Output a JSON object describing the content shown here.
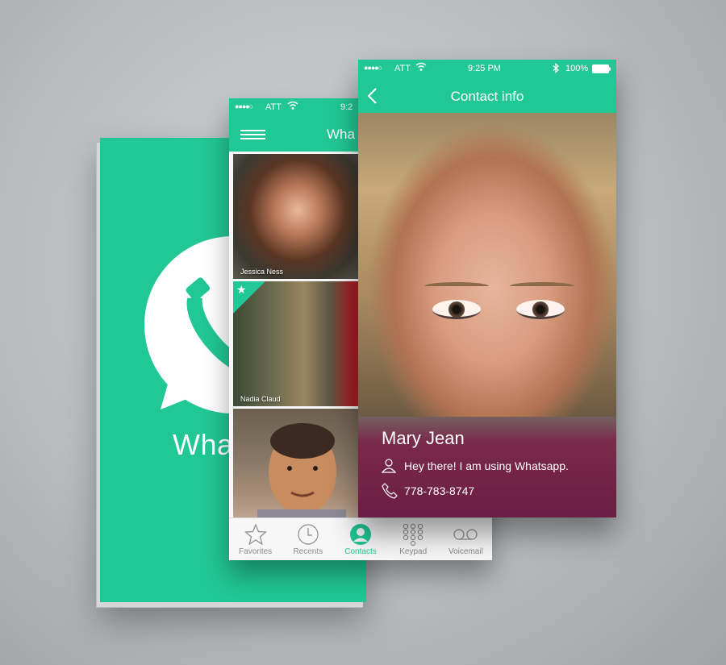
{
  "splash": {
    "brand": "Wha",
    "logo_icon": "whatsapp-phone-bubble-icon",
    "background": "#21c794"
  },
  "contacts_screen": {
    "status": {
      "carrier": "ATT",
      "time": "9:2",
      "signal_dots": "●●●●○"
    },
    "title": "Wha",
    "contacts": [
      {
        "name": "Jessica Ness"
      },
      {
        "name": "Nadia Claud",
        "favorite": true
      },
      {
        "name": ""
      }
    ],
    "tabs": [
      {
        "label": "Favorites",
        "icon": "star-icon",
        "active": false
      },
      {
        "label": "Recents",
        "icon": "clock-icon",
        "active": false
      },
      {
        "label": "Contacts",
        "icon": "person-icon",
        "active": true
      },
      {
        "label": "Keypad",
        "icon": "keypad-icon",
        "active": false
      },
      {
        "label": "Voicemail",
        "icon": "voicemail-icon",
        "active": false
      }
    ]
  },
  "info_screen": {
    "status": {
      "carrier": "ATT",
      "time": "9:25 PM",
      "battery": "100%",
      "signal_dots": "●●●●○"
    },
    "title": "Contact info",
    "contact": {
      "name": "Mary Jean",
      "status_message": "Hey there! I am using Whatsapp.",
      "phone": "778-783-8747"
    }
  },
  "colors": {
    "accent": "#21c794",
    "panel": "#6b1e43"
  }
}
